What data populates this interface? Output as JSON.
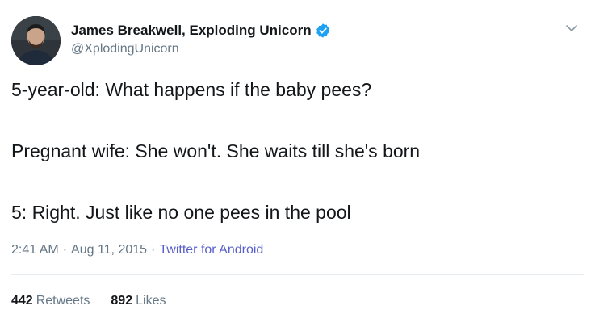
{
  "author": {
    "display_name": "James Breakwell, Exploding Unicorn",
    "handle": "@XplodingUnicorn",
    "verified": true,
    "avatar_icon": "user-avatar"
  },
  "tweet": {
    "lines": [
      "5-year-old: What happens if the baby pees?",
      "Pregnant wife: She won't. She waits till she's born",
      "5: Right. Just like no one pees in the pool"
    ]
  },
  "meta": {
    "time": "2:41 AM",
    "separator": "·",
    "date": "Aug 11, 2015",
    "source": "Twitter for Android"
  },
  "stats": {
    "retweets_count": "442",
    "retweets_label": "Retweets",
    "likes_count": "892",
    "likes_label": "Likes"
  },
  "icons": {
    "verified": "verified-badge-icon",
    "more": "chevron-down-icon"
  },
  "colors": {
    "verified_blue": "#1da1f2",
    "secondary_text": "#657786",
    "source_link": "#5a5fc8"
  }
}
